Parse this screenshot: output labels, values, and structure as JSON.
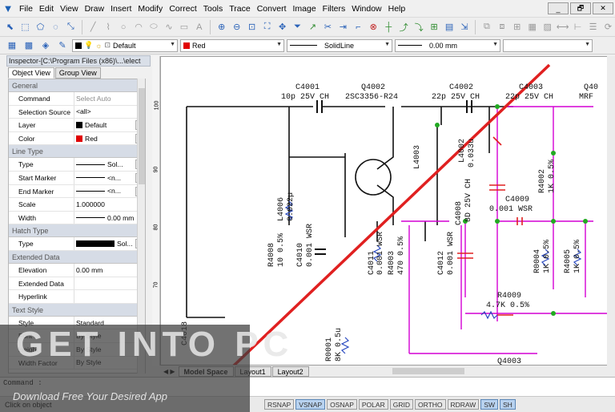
{
  "menu": [
    "File",
    "Edit",
    "View",
    "Draw",
    "Insert",
    "Modify",
    "Correct",
    "Tools",
    "Trace",
    "Convert",
    "Image",
    "Filters",
    "Window",
    "Help"
  ],
  "window_buttons": [
    "_",
    "🗗",
    "✕"
  ],
  "props_bar": {
    "layer": "Default",
    "color": "Red",
    "linetype": "SolidLine",
    "lineweight": "0.00 mm"
  },
  "inspector": {
    "title": "Inspector-[C:\\Program Files (x86)\\...\\elect",
    "tabs": [
      "Object View",
      "Group View"
    ],
    "sections": [
      {
        "name": "General",
        "rows": [
          {
            "key": "Command",
            "value": "Select Auto",
            "muted": true
          },
          {
            "key": "Selection Source",
            "value": "<all>"
          },
          {
            "key": "Layer",
            "value": "Default",
            "swatch": "#000000"
          },
          {
            "key": "Color",
            "value": "Red",
            "swatch": "#e00000"
          }
        ]
      },
      {
        "name": "Line Type",
        "rows": [
          {
            "key": "Type",
            "value": "Sol..."
          },
          {
            "key": "Start Marker",
            "value": "<n..."
          },
          {
            "key": "End Marker",
            "value": "<n..."
          },
          {
            "key": "Scale",
            "value": "1.000000"
          },
          {
            "key": "Width",
            "value": "0.00 mm"
          }
        ]
      },
      {
        "name": "Hatch Type",
        "rows": [
          {
            "key": "Type",
            "value": "Sol..."
          }
        ]
      },
      {
        "name": "Extended Data",
        "rows": [
          {
            "key": "Elevation",
            "value": "0.00 mm"
          },
          {
            "key": "Extended Data",
            "value": ""
          },
          {
            "key": "Hyperlink",
            "value": ""
          }
        ]
      },
      {
        "name": "Text Style",
        "rows": [
          {
            "key": "Style",
            "value": "Standard"
          },
          {
            "key": "Font",
            "value": "By Style"
          },
          {
            "key": "Height",
            "value": "By Style"
          },
          {
            "key": "Width Factor",
            "value": "By Style"
          }
        ]
      }
    ]
  },
  "ruler_ticks": [
    "100",
    "90",
    "80",
    "70"
  ],
  "schematic_labels": [
    "C4001",
    "10p  25V CH",
    "Q4002",
    "2SC3356-R24",
    "C4002",
    "22p  25V CH",
    "C4003",
    "22p  25V CH",
    "Q40",
    "MRF",
    "L4006",
    "0.022µ",
    "R4008",
    "10  0.5%",
    "C4010",
    "0.001  WSR",
    "C4018",
    "C4011",
    "0.001  WSR",
    "R4003",
    "470  0.5%",
    "C4012",
    "0.001  WSR",
    "L4003",
    "L4002",
    "0.033u",
    "C4008",
    "8D  25V CH",
    "R4002",
    "1K  0.5%",
    "C4009",
    "0.001  WSR",
    "R0004",
    "1K  0.5%",
    "R4005",
    "1K  0.5%",
    "R4009",
    "4.7K 0.5%",
    "R0001",
    "8K  0.5u",
    "Q4003"
  ],
  "layout_tabs": [
    "Model Space",
    "Layout1",
    "Layout2"
  ],
  "command_label": "Command :",
  "status_message": "Click on object",
  "status_buttons": [
    {
      "label": "RSNAP",
      "on": false
    },
    {
      "label": "VSNAP",
      "on": true
    },
    {
      "label": "OSNAP",
      "on": false
    },
    {
      "label": "POLAR",
      "on": false
    },
    {
      "label": "GRID",
      "on": false
    },
    {
      "label": "ORTHO",
      "on": false
    },
    {
      "label": "RDRAW",
      "on": false
    },
    {
      "label": "SW",
      "on": true
    },
    {
      "label": "SH",
      "on": true
    }
  ],
  "watermark": {
    "title": "GET INTO PC",
    "tagline": "Download Free Your Desired App"
  },
  "colors": {
    "accent": "#2a62b8",
    "trace_line": "#e02020",
    "magenta_wire": "#d400d4",
    "node": "#22aa22"
  }
}
